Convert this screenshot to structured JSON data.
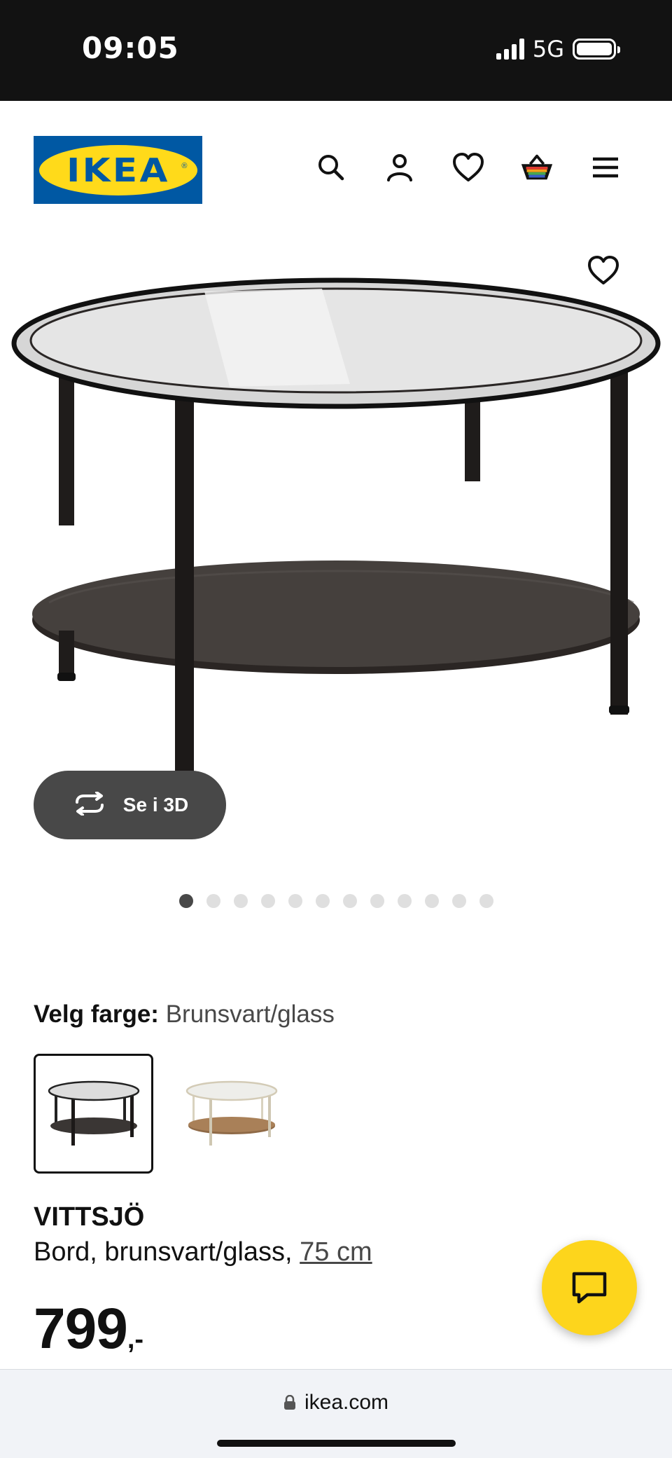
{
  "status_bar": {
    "time": "09:05",
    "network": "5G"
  },
  "header": {
    "logo_text": "IKEA",
    "icons": [
      "search-icon",
      "user-icon",
      "heart-icon",
      "basket-icon",
      "menu-icon"
    ]
  },
  "product": {
    "image_icon": "glass-coffee-table",
    "view_3d_label": "Se i 3D",
    "gallery_count": 12,
    "gallery_active_index": 0,
    "color_label": "Velg farge:",
    "color_value": "Brunsvart/glass",
    "swatches": [
      {
        "icon": "black-brown-table-thumbnail",
        "selected": true
      },
      {
        "icon": "white-oak-table-thumbnail",
        "selected": false
      }
    ],
    "name": "VITTSJÖ",
    "description": "Bord, brunsvart/glass, ",
    "size": "75 cm",
    "price": "799",
    "price_suffix": ",-"
  },
  "browser": {
    "url": "ikea.com"
  },
  "colors": {
    "ikea_blue": "#0058a3",
    "ikea_yellow": "#ffda1a",
    "chat_yellow": "#fdd51c",
    "status_bar_bg": "#121212",
    "pill_bg": "#484848"
  }
}
